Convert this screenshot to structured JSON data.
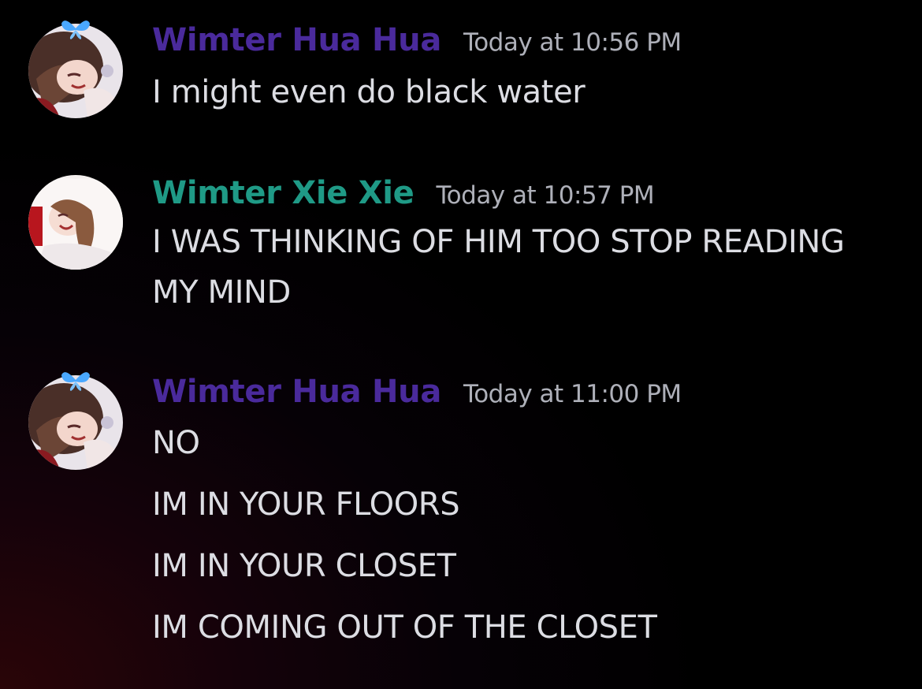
{
  "colors": {
    "hua_name": "#4a2a9c",
    "xie_name": "#1f9a86",
    "timestamp": "#aeb0b9",
    "text": "#dcdde3"
  },
  "messages": [
    {
      "author": "Wimter Hua Hua",
      "timestamp": "Today at 10:56 PM",
      "avatar_icon": "avatar-hua-hua-icon",
      "lines": [
        "I might even do black water"
      ]
    },
    {
      "author": "Wimter Xie Xie",
      "timestamp": "Today at 10:57 PM",
      "avatar_icon": "avatar-xie-xie-icon",
      "lines": [
        "I WAS THINKING OF HIM TOO STOP READING",
        "MY MIND"
      ]
    },
    {
      "author": "Wimter Hua Hua",
      "timestamp": "Today at 11:00 PM",
      "avatar_icon": "avatar-hua-hua-icon",
      "lines": [
        "NO",
        "IM IN YOUR FLOORS",
        "IM IN YOUR CLOSET",
        "IM COMING OUT OF THE CLOSET"
      ]
    }
  ]
}
